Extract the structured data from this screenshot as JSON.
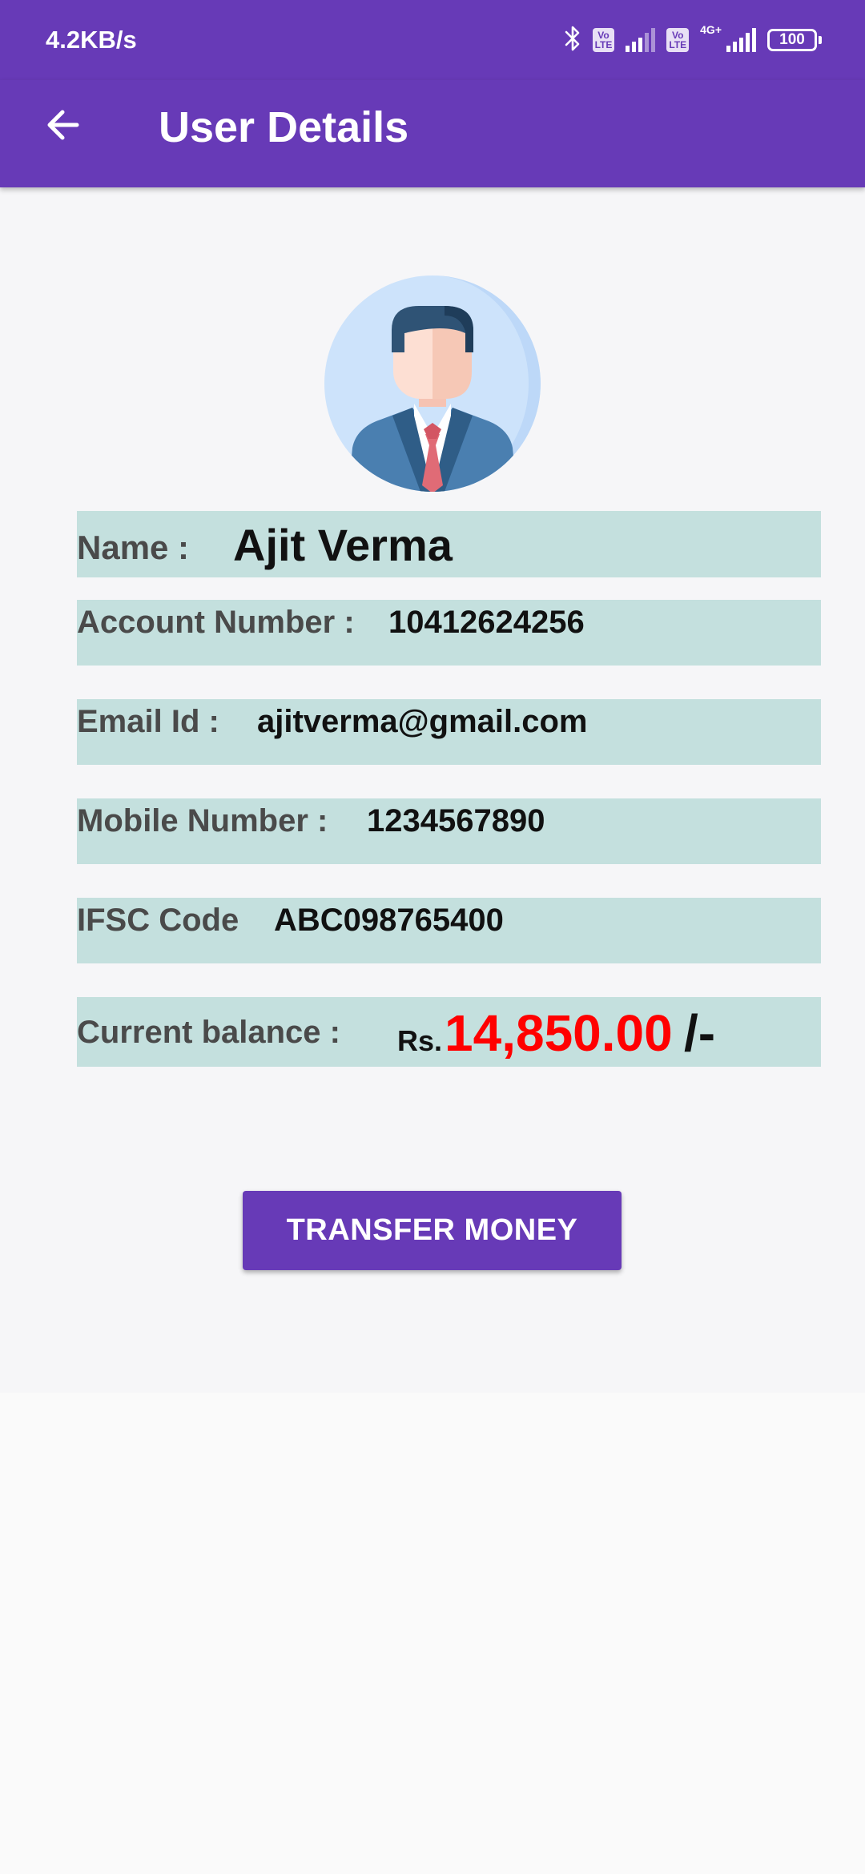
{
  "status_bar": {
    "speed": "4.2KB/s",
    "sim1_badge_line1": "Vo",
    "sim1_badge_line2": "LTE",
    "sim2_badge_line1": "Vo",
    "sim2_badge_line2": "LTE",
    "network_type": "4G+",
    "battery_level": "100",
    "icons": [
      "bluetooth-icon",
      "volte-icon",
      "signal-icon",
      "volte-icon",
      "signal-icon",
      "battery-icon"
    ]
  },
  "app_bar": {
    "title": "User Details",
    "back_icon": "arrow-left-icon"
  },
  "user": {
    "avatar_icon": "businessman-avatar-icon",
    "name_label": "Name :",
    "name": "Ajit Verma",
    "account_label": "Account Number :",
    "account_number": "10412624256",
    "email_label": "Email Id :",
    "email": "ajitverma@gmail.com",
    "mobile_label": "Mobile Number :",
    "mobile": "1234567890",
    "ifsc_label": "IFSC Code",
    "ifsc": "ABC098765400",
    "balance_label": "Current balance :",
    "balance_prefix": "Rs.",
    "balance_amount": "14,850.00",
    "balance_suffix": "/-"
  },
  "actions": {
    "transfer_label": "TRANSFER MONEY"
  },
  "colors": {
    "primary": "#673ab7",
    "row_background": "#c4e0de",
    "balance": "#ff0000"
  }
}
